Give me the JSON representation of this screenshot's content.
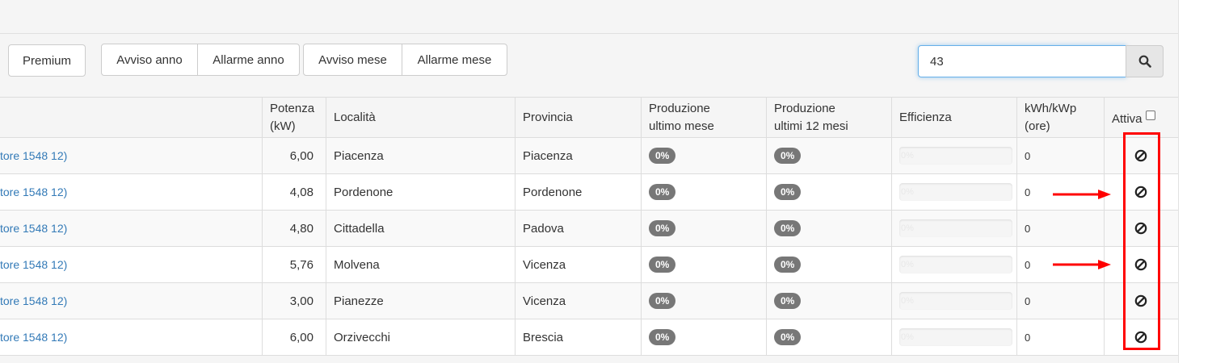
{
  "toolbar": {
    "premium": "Premium",
    "group1": [
      "Avviso anno",
      "Allarme anno"
    ],
    "group2": [
      "Avviso mese",
      "Allarme mese"
    ],
    "search_value": "43"
  },
  "table": {
    "headers": {
      "potenza": [
        "Potenza",
        "(kW)"
      ],
      "localita": "Località",
      "provincia": "Provincia",
      "prod_mese": [
        "Produzione",
        "ultimo mese"
      ],
      "prod_12": [
        "Produzione",
        "ultimi 12 mesi"
      ],
      "efficienza": "Efficienza",
      "kwh": [
        "kWh/kWp",
        "(ore)"
      ],
      "attiva": "Attiva"
    },
    "rows": [
      {
        "name": "tore 1548 12)",
        "potenza": "6,00",
        "localita": "Piacenza",
        "provincia": "Piacenza",
        "prod_mese": "0%",
        "prod_12": "0%",
        "efficienza": "0%",
        "kwh": "0"
      },
      {
        "name": "tore 1548 12)",
        "potenza": "4,08",
        "localita": "Pordenone",
        "provincia": "Pordenone",
        "prod_mese": "0%",
        "prod_12": "0%",
        "efficienza": "0%",
        "kwh": "0"
      },
      {
        "name": "tore 1548 12)",
        "potenza": "4,80",
        "localita": "Cittadella",
        "provincia": "Padova",
        "prod_mese": "0%",
        "prod_12": "0%",
        "efficienza": "0%",
        "kwh": "0"
      },
      {
        "name": "tore 1548 12)",
        "potenza": "5,76",
        "localita": "Molvena",
        "provincia": "Vicenza",
        "prod_mese": "0%",
        "prod_12": "0%",
        "efficienza": "0%",
        "kwh": "0"
      },
      {
        "name": "tore 1548 12)",
        "potenza": "3,00",
        "localita": "Pianezze",
        "provincia": "Vicenza",
        "prod_mese": "0%",
        "prod_12": "0%",
        "efficienza": "0%",
        "kwh": "0"
      },
      {
        "name": "tore 1548 12)",
        "potenza": "6,00",
        "localita": "Orzivecchi",
        "provincia": "Brescia",
        "prod_mese": "0%",
        "prod_12": "0%",
        "efficienza": "0%",
        "kwh": "0"
      }
    ]
  },
  "colors": {
    "link": "#337ab7",
    "badge": "#777777",
    "highlight": "#ff0000",
    "focus": "#66afe9"
  },
  "icons": {
    "search": "search-icon",
    "attiva": "ban-icon"
  }
}
